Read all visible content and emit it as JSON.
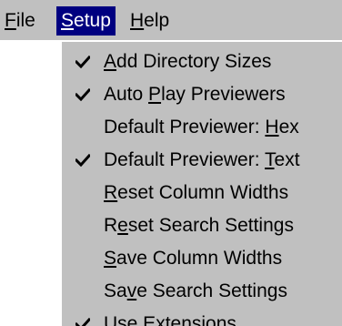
{
  "menubar": {
    "items": [
      {
        "id": "file",
        "pre": "",
        "acc": "F",
        "post": "ile",
        "active": false
      },
      {
        "id": "setup",
        "pre": "",
        "acc": "S",
        "post": "etup",
        "active": true
      },
      {
        "id": "help",
        "pre": "",
        "acc": "H",
        "post": "elp",
        "active": false
      }
    ]
  },
  "setup_menu": {
    "items": [
      {
        "pre": "",
        "acc": "A",
        "post": "dd Directory Sizes",
        "checked": true
      },
      {
        "pre": "Auto ",
        "acc": "P",
        "post": "lay Previewers",
        "checked": true
      },
      {
        "pre": "Default Previewer: ",
        "acc": "H",
        "post": "ex",
        "checked": false
      },
      {
        "pre": "Default Previewer: ",
        "acc": "T",
        "post": "ext",
        "checked": true
      },
      {
        "pre": "",
        "acc": "R",
        "post": "eset Column Widths",
        "checked": false
      },
      {
        "pre": "R",
        "acc": "e",
        "post": "set Search Settings",
        "checked": false
      },
      {
        "pre": "",
        "acc": "S",
        "post": "ave Column Widths",
        "checked": false
      },
      {
        "pre": "Sa",
        "acc": "v",
        "post": "e Search Settings",
        "checked": false
      },
      {
        "pre": "",
        "acc": "U",
        "post": "se Extensions",
        "checked": true
      }
    ]
  },
  "colors": {
    "menu_face": "#c0c0c0",
    "highlight": "#000080",
    "highlight_text": "#ffffff",
    "text": "#000000"
  },
  "icons": {
    "checkmark": "checkmark-icon"
  }
}
